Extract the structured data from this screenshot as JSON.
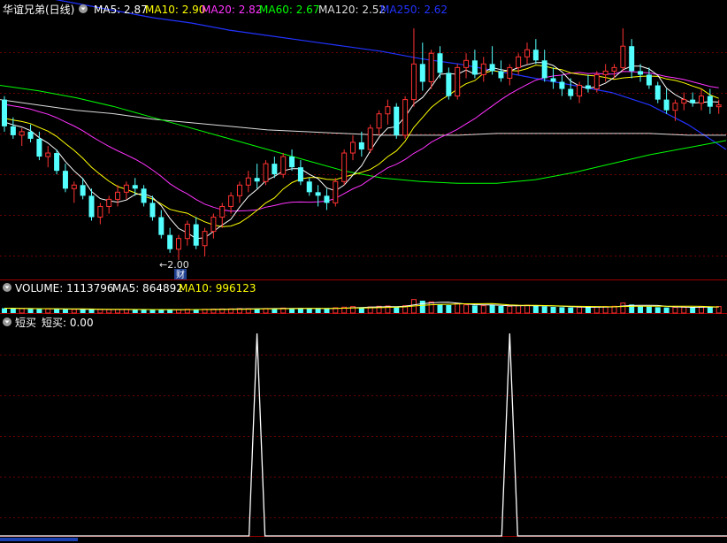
{
  "main_header": {
    "stock_name": "华谊兄弟(日线)",
    "ma": [
      {
        "label": "MA5: 2.87",
        "color": "#ffffff"
      },
      {
        "label": "MA10: 2.90",
        "color": "#ffff00"
      },
      {
        "label": "MA20: 2.82",
        "color": "#ff33ff"
      },
      {
        "label": "MA60: 2.67",
        "color": "#00ff00"
      },
      {
        "label": "MA120: 2.52",
        "color": "#dddddd"
      },
      {
        "label": "MA250: 2.62",
        "color": "#2233ff"
      }
    ]
  },
  "annotations": {
    "low_marker": "←2.00",
    "badge": "财"
  },
  "volume_header": {
    "items": [
      {
        "label": "VOLUME: 1113796",
        "color": "#ffffff"
      },
      {
        "label": "MA5: 864892",
        "color": "#ffffff"
      },
      {
        "label": "MA10: 996123",
        "color": "#ffff00"
      }
    ]
  },
  "indicator_header": {
    "name": "短买",
    "value_label": "短买: 0.00"
  },
  "colors": {
    "up": "#ff3232",
    "down": "#54ffff",
    "grid": "#6e0000",
    "border": "#9a0000"
  },
  "chart_data": [
    {
      "type": "candlestick",
      "title": "华谊兄弟(日线)",
      "low_label": 2.0,
      "ylim": [
        1.9,
        3.35
      ],
      "ohlc": [
        [
          2.9,
          2.92,
          2.72,
          2.75
        ],
        [
          2.75,
          2.8,
          2.68,
          2.7
        ],
        [
          2.7,
          2.74,
          2.64,
          2.72
        ],
        [
          2.72,
          2.76,
          2.66,
          2.68
        ],
        [
          2.68,
          2.72,
          2.56,
          2.58
        ],
        [
          2.58,
          2.64,
          2.52,
          2.6
        ],
        [
          2.6,
          2.62,
          2.48,
          2.5
        ],
        [
          2.5,
          2.54,
          2.38,
          2.4
        ],
        [
          2.4,
          2.44,
          2.32,
          2.42
        ],
        [
          2.42,
          2.46,
          2.34,
          2.36
        ],
        [
          2.36,
          2.4,
          2.22,
          2.24
        ],
        [
          2.24,
          2.32,
          2.2,
          2.3
        ],
        [
          2.3,
          2.36,
          2.26,
          2.34
        ],
        [
          2.34,
          2.42,
          2.3,
          2.38
        ],
        [
          2.38,
          2.44,
          2.34,
          2.42
        ],
        [
          2.42,
          2.46,
          2.36,
          2.4
        ],
        [
          2.4,
          2.42,
          2.3,
          2.32
        ],
        [
          2.32,
          2.36,
          2.22,
          2.24
        ],
        [
          2.24,
          2.28,
          2.12,
          2.14
        ],
        [
          2.14,
          2.18,
          2.04,
          2.06
        ],
        [
          2.06,
          2.14,
          2.0,
          2.12
        ],
        [
          2.12,
          2.22,
          2.08,
          2.2
        ],
        [
          2.2,
          2.24,
          2.06,
          2.08
        ],
        [
          2.08,
          2.18,
          2.02,
          2.16
        ],
        [
          2.16,
          2.26,
          2.12,
          2.24
        ],
        [
          2.24,
          2.32,
          2.18,
          2.3
        ],
        [
          2.3,
          2.38,
          2.26,
          2.36
        ],
        [
          2.36,
          2.44,
          2.32,
          2.42
        ],
        [
          2.42,
          2.5,
          2.38,
          2.46
        ],
        [
          2.46,
          2.54,
          2.4,
          2.44
        ],
        [
          2.44,
          2.56,
          2.42,
          2.54
        ],
        [
          2.54,
          2.58,
          2.46,
          2.48
        ],
        [
          2.48,
          2.6,
          2.46,
          2.58
        ],
        [
          2.58,
          2.62,
          2.5,
          2.52
        ],
        [
          2.52,
          2.56,
          2.42,
          2.44
        ],
        [
          2.44,
          2.46,
          2.36,
          2.38
        ],
        [
          2.38,
          2.42,
          2.3,
          2.36
        ],
        [
          2.36,
          2.4,
          2.28,
          2.32
        ],
        [
          2.32,
          2.46,
          2.3,
          2.44
        ],
        [
          2.44,
          2.62,
          2.42,
          2.6
        ],
        [
          2.6,
          2.7,
          2.56,
          2.66
        ],
        [
          2.66,
          2.72,
          2.58,
          2.62
        ],
        [
          2.62,
          2.76,
          2.6,
          2.74
        ],
        [
          2.74,
          2.84,
          2.7,
          2.82
        ],
        [
          2.82,
          2.9,
          2.76,
          2.86
        ],
        [
          2.86,
          2.88,
          2.68,
          2.7
        ],
        [
          2.7,
          2.92,
          2.68,
          2.9
        ],
        [
          2.9,
          3.3,
          2.86,
          3.1
        ],
        [
          3.1,
          3.22,
          2.95,
          3.0
        ],
        [
          3.0,
          3.18,
          2.96,
          3.16
        ],
        [
          3.16,
          3.2,
          3.02,
          3.05
        ],
        [
          3.05,
          3.08,
          2.9,
          2.92
        ],
        [
          2.92,
          3.1,
          2.9,
          3.08
        ],
        [
          3.08,
          3.16,
          3.02,
          3.12
        ],
        [
          3.12,
          3.18,
          3.02,
          3.04
        ],
        [
          3.04,
          3.14,
          3.0,
          3.1
        ],
        [
          3.1,
          3.2,
          3.04,
          3.06
        ],
        [
          3.06,
          3.12,
          3.0,
          3.02
        ],
        [
          3.02,
          3.1,
          2.98,
          3.08
        ],
        [
          3.08,
          3.16,
          3.04,
          3.14
        ],
        [
          3.14,
          3.22,
          3.1,
          3.18
        ],
        [
          3.18,
          3.24,
          3.1,
          3.12
        ],
        [
          3.12,
          3.18,
          3.0,
          3.02
        ],
        [
          3.02,
          3.08,
          2.96,
          3.0
        ],
        [
          3.0,
          3.04,
          2.92,
          2.96
        ],
        [
          2.96,
          3.02,
          2.9,
          2.92
        ],
        [
          2.92,
          3.0,
          2.88,
          2.98
        ],
        [
          2.98,
          3.04,
          2.94,
          2.96
        ],
        [
          2.96,
          3.06,
          2.94,
          3.04
        ],
        [
          3.04,
          3.1,
          3.0,
          3.06
        ],
        [
          3.06,
          3.1,
          3.02,
          3.08
        ],
        [
          3.08,
          3.3,
          3.06,
          3.2
        ],
        [
          3.2,
          3.24,
          3.02,
          3.06
        ],
        [
          3.06,
          3.1,
          3.0,
          3.04
        ],
        [
          3.04,
          3.08,
          2.96,
          2.98
        ],
        [
          2.98,
          3.0,
          2.88,
          2.9
        ],
        [
          2.9,
          2.96,
          2.82,
          2.84
        ],
        [
          2.84,
          2.9,
          2.78,
          2.88
        ],
        [
          2.88,
          2.94,
          2.84,
          2.9
        ],
        [
          2.9,
          2.94,
          2.86,
          2.88
        ],
        [
          2.88,
          2.96,
          2.84,
          2.92
        ],
        [
          2.92,
          2.96,
          2.82,
          2.86
        ],
        [
          2.86,
          2.9,
          2.82,
          2.87
        ]
      ],
      "ma5_start": 2.78,
      "ma10_start": 2.8,
      "ma20_start": 2.88,
      "ma60": [
        2.98,
        2.95,
        2.91,
        2.86,
        2.8,
        2.74,
        2.68,
        2.62,
        2.56,
        2.5,
        2.46,
        2.44,
        2.43,
        2.43,
        2.45,
        2.49,
        2.54,
        2.59,
        2.63,
        2.67
      ],
      "ma120": [
        2.9,
        2.87,
        2.84,
        2.82,
        2.79,
        2.77,
        2.75,
        2.73,
        2.72,
        2.71,
        2.7,
        2.7,
        2.7,
        2.71,
        2.71,
        2.71,
        2.71,
        2.71,
        2.7,
        2.7
      ],
      "ma250": [
        3.52,
        3.48,
        3.44,
        3.4,
        3.36,
        3.33,
        3.29,
        3.26,
        3.23,
        3.2,
        3.17,
        3.13,
        3.1,
        3.06,
        3.02,
        2.98,
        2.94,
        2.87,
        2.76,
        2.62
      ]
    },
    {
      "type": "bar",
      "name": "VOLUME",
      "ylim": [
        0,
        3000000
      ],
      "values": [
        820000,
        790000,
        760000,
        710000,
        690000,
        700000,
        680000,
        650000,
        620000,
        610000,
        640000,
        600000,
        580000,
        610000,
        620000,
        600000,
        590000,
        560000,
        570000,
        560000,
        600000,
        650000,
        620000,
        640000,
        680000,
        700000,
        720000,
        760000,
        740000,
        720000,
        780000,
        800000,
        850000,
        820000,
        780000,
        760000,
        740000,
        760000,
        900000,
        1000000,
        1100000,
        980000,
        1050000,
        1150000,
        1200000,
        1100000,
        1250000,
        2300000,
        2100000,
        1900000,
        1500000,
        1350000,
        1600000,
        1400000,
        1300000,
        1250000,
        1350000,
        1200000,
        1150000,
        1300000,
        1350000,
        1250000,
        1150000,
        1050000,
        1000000,
        950000,
        1000000,
        980000,
        1050000,
        1100000,
        1150000,
        1700000,
        1450000,
        1200000,
        1100000,
        1000000,
        950000,
        980000,
        1000000,
        950000,
        1050000,
        1080000,
        1113796
      ]
    },
    {
      "type": "line",
      "name": "短买",
      "ylim": [
        0,
        1
      ],
      "spikes": [
        29,
        58
      ]
    }
  ]
}
